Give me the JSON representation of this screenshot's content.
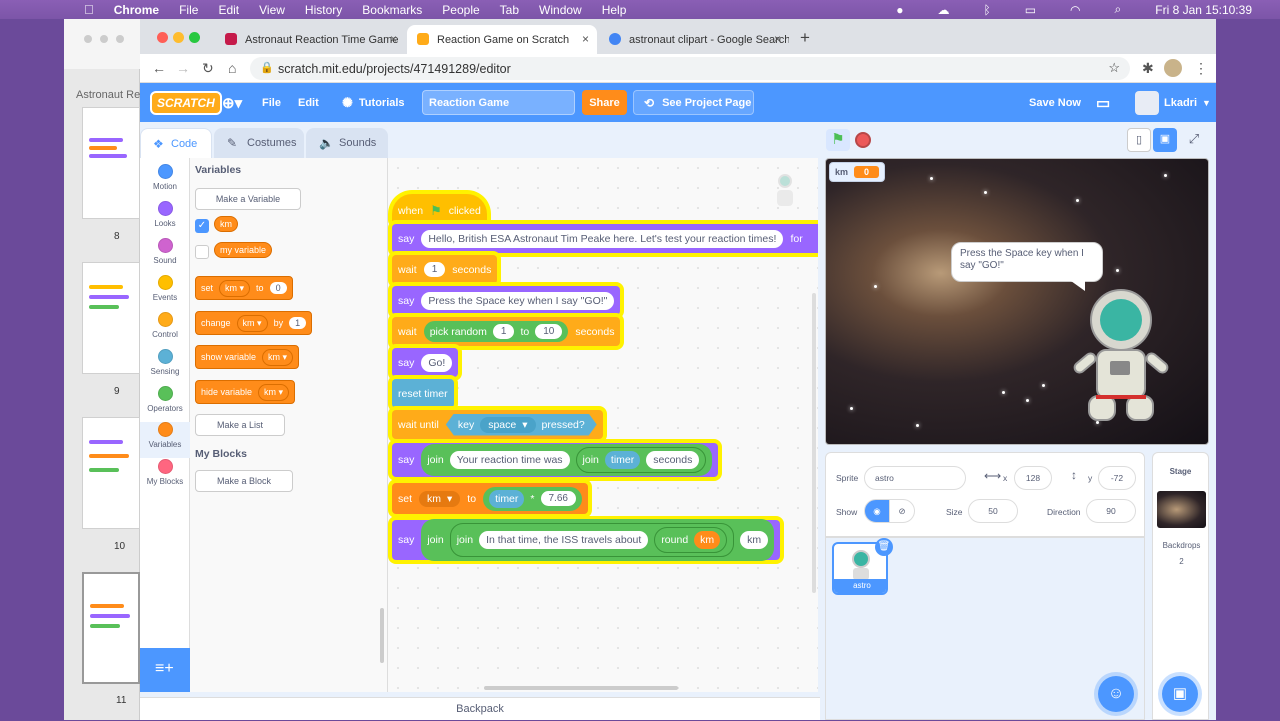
{
  "os_menu": {
    "apple": "",
    "app": "Chrome",
    "items": [
      "File",
      "Edit",
      "View",
      "History",
      "Bookmarks",
      "People",
      "Tab",
      "Window",
      "Help"
    ],
    "clock": "Fri 8 Jan  15:10:39"
  },
  "slides_panel": {
    "title": "Astronaut Re",
    "numbers": [
      "8",
      "9",
      "10",
      "11"
    ]
  },
  "browser": {
    "tabs": [
      {
        "title": "Astronaut Reaction Time Game",
        "close": "×"
      },
      {
        "title": "Reaction Game on Scratch",
        "close": "×"
      },
      {
        "title": "astronaut clipart - Google Search",
        "close": "×"
      }
    ],
    "new_tab": "+",
    "url": "scratch.mit.edu/projects/471491289/editor"
  },
  "scratch_menu": {
    "logo": "SCRATCH",
    "file": "File",
    "edit": "Edit",
    "tutorials": "Tutorials",
    "project_name": "Reaction Game",
    "share": "Share",
    "see_project": "See Project Page",
    "save_now": "Save Now",
    "user": "Lkadri"
  },
  "editor_tabs": {
    "code": "Code",
    "costumes": "Costumes",
    "sounds": "Sounds"
  },
  "categories": [
    {
      "label": "Motion",
      "color": "#4c97ff"
    },
    {
      "label": "Looks",
      "color": "#9966ff"
    },
    {
      "label": "Sound",
      "color": "#cf63cf"
    },
    {
      "label": "Events",
      "color": "#ffbf00"
    },
    {
      "label": "Control",
      "color": "#ffab19"
    },
    {
      "label": "Sensing",
      "color": "#5cb1d6"
    },
    {
      "label": "Operators",
      "color": "#59c059"
    },
    {
      "label": "Variables",
      "color": "#ff8c1a"
    },
    {
      "label": "My Blocks",
      "color": "#ff6680"
    }
  ],
  "palette": {
    "variables_heading": "Variables",
    "make_variable": "Make a Variable",
    "var_km": "km",
    "var_my": "my variable",
    "set_block": {
      "op": "set",
      "var": "km",
      "to": "to",
      "value": "0"
    },
    "change_block": {
      "op": "change",
      "var": "km",
      "by": "by",
      "value": "1"
    },
    "show_block": {
      "op": "show variable",
      "var": "km"
    },
    "hide_block": {
      "op": "hide variable",
      "var": "km"
    },
    "make_list": "Make a List",
    "myblocks_heading": "My Blocks",
    "make_block": "Make a Block"
  },
  "script": {
    "hat": {
      "when": "when",
      "clicked": "clicked"
    },
    "say1": {
      "op": "say",
      "text": "Hello, British ESA Astronaut Tim Peake here. Let's test your reaction times!",
      "for": "for"
    },
    "wait1": {
      "op": "wait",
      "value": "1",
      "unit": "seconds"
    },
    "say2": {
      "op": "say",
      "text": "Press the Space key when I say \"GO!\""
    },
    "wait2": {
      "op": "wait",
      "fn": "pick random",
      "a": "1",
      "to": "to",
      "b": "10",
      "unit": "seconds"
    },
    "say3": {
      "op": "say",
      "text": "Go!"
    },
    "reset": "reset timer",
    "waituntil": {
      "op": "wait until",
      "key": "key",
      "keyname": "space",
      "pressed": "pressed?"
    },
    "say4": {
      "op": "say",
      "join": "join",
      "text": "Your reaction time was",
      "join2": "join",
      "timer": "timer",
      "unit": "seconds"
    },
    "set": {
      "op": "set",
      "var": "km",
      "to": "to",
      "timer": "timer",
      "mul": "*",
      "value": "7.66"
    },
    "say5": {
      "op": "say",
      "join": "join",
      "join2": "join",
      "text": "In that time, the ISS travels about",
      "round": "round",
      "km": "km",
      "km2": "km"
    },
    "backpack": "Backpack"
  },
  "stage": {
    "monitor_label": "km",
    "monitor_value": "0",
    "speech": "Press the Space key when I say \"GO!\""
  },
  "sprite_info": {
    "sprite_label": "Sprite",
    "sprite_name": "astro",
    "x_label": "x",
    "x_value": "128",
    "y_label": "y",
    "y_value": "-72",
    "show_label": "Show",
    "size_label": "Size",
    "size_value": "50",
    "direction_label": "Direction",
    "direction_value": "90",
    "sprite_thumb_label": "astro"
  },
  "stage_panel": {
    "title": "Stage",
    "backdrops_label": "Backdrops",
    "backdrops_count": "2"
  }
}
